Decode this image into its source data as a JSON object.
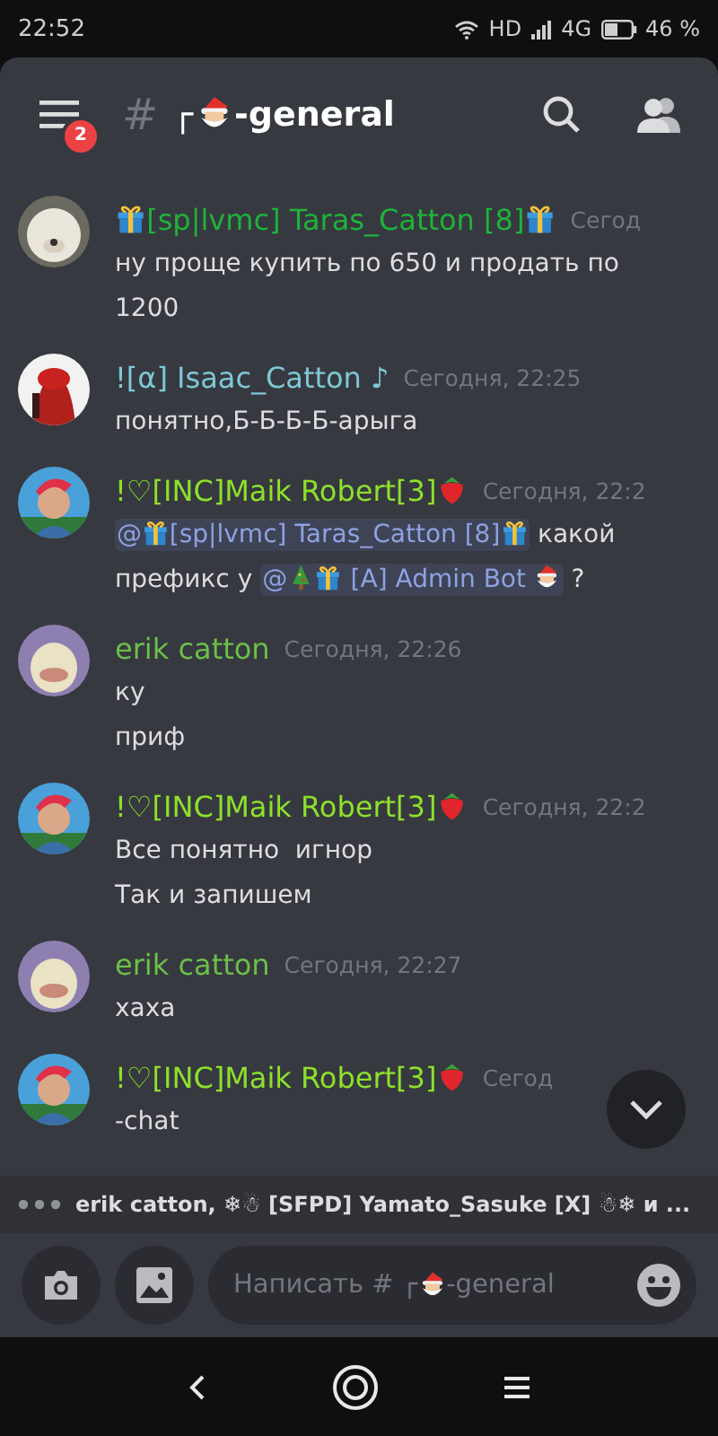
{
  "status_bar": {
    "time": "22:52",
    "network": "HD",
    "cellular": "4G",
    "battery": "46 %"
  },
  "header": {
    "unread_badge": "2",
    "channel_prefix": "#",
    "channel_title": [
      {
        "kind": "text",
        "text": "┌"
      },
      {
        "kind": "santa"
      },
      {
        "kind": "text",
        "text": "-general"
      }
    ]
  },
  "messages": [
    {
      "author": [
        {
          "kind": "gift"
        },
        {
          "kind": "text",
          "text": "[sp|lvmc] Taras_Catton [8]"
        },
        {
          "kind": "gift"
        }
      ],
      "color": "#1fb23a",
      "timestamp": "Сегод",
      "lines": [
        [
          {
            "kind": "text",
            "text": "ну проще купить по 650 и продать по 1200"
          }
        ]
      ]
    },
    {
      "author": [
        {
          "kind": "text",
          "text": "![α] Isaac_Catton ♪"
        }
      ],
      "color": "#7ec8d6",
      "timestamp": "Сегодня, 22:25",
      "lines": [
        [
          {
            "kind": "text",
            "text": "понятно,Б-Б-Б-Б-арыга"
          }
        ]
      ]
    },
    {
      "author": [
        {
          "kind": "text",
          "text": "!♡[INC]Maik Robert[3]"
        },
        {
          "kind": "strawberry"
        }
      ],
      "color": "#8ee02c",
      "timestamp": "Сегодня, 22:2",
      "lines": [
        [
          {
            "kind": "mention",
            "parts": [
              {
                "kind": "text",
                "text": "@"
              },
              {
                "kind": "gift"
              },
              {
                "kind": "text",
                "text": "[sp|lvmc] Taras_Catton [8]"
              },
              {
                "kind": "gift"
              }
            ]
          },
          {
            "kind": "text",
            "text": " какой префикс у "
          },
          {
            "kind": "mention",
            "parts": [
              {
                "kind": "text",
                "text": "@"
              },
              {
                "kind": "tree"
              },
              {
                "kind": "gift"
              },
              {
                "kind": "text",
                "text": " [A] Admin Bot "
              },
              {
                "kind": "santa"
              }
            ]
          },
          {
            "kind": "text",
            "text": " ?"
          }
        ]
      ]
    },
    {
      "author": [
        {
          "kind": "text",
          "text": "erik catton"
        }
      ],
      "color": "#6cbf4a",
      "timestamp": "Сегодня, 22:26",
      "lines": [
        [
          {
            "kind": "text",
            "text": "ку"
          }
        ],
        [
          {
            "kind": "text",
            "text": "приф"
          }
        ]
      ]
    },
    {
      "author": [
        {
          "kind": "text",
          "text": "!♡[INC]Maik Robert[3]"
        },
        {
          "kind": "strawberry"
        }
      ],
      "color": "#8ee02c",
      "timestamp": "Сегодня, 22:2",
      "lines": [
        [
          {
            "kind": "text",
            "text": "Все понятно  игнор"
          }
        ],
        [
          {
            "kind": "text",
            "text": "Так и запишем"
          }
        ]
      ]
    },
    {
      "author": [
        {
          "kind": "text",
          "text": "erik catton"
        }
      ],
      "color": "#6cbf4a",
      "timestamp": "Сегодня, 22:27",
      "lines": [
        [
          {
            "kind": "text",
            "text": "хаха"
          }
        ]
      ]
    },
    {
      "author": [
        {
          "kind": "text",
          "text": "!♡[INC]Maik Robert[3]"
        },
        {
          "kind": "strawberry"
        }
      ],
      "color": "#8ee02c",
      "timestamp": "Сегод",
      "lines": [
        [
          {
            "kind": "text",
            "text": "-chat"
          }
        ]
      ]
    }
  ],
  "typing": "erik catton, ❄☃ [SFPD] Yamato_Sasuke [X] ☃❄ и ...",
  "composer": {
    "placeholder": [
      {
        "kind": "text",
        "text": "Написать # ┌"
      },
      {
        "kind": "santa"
      },
      {
        "kind": "text",
        "text": "-general"
      }
    ]
  }
}
